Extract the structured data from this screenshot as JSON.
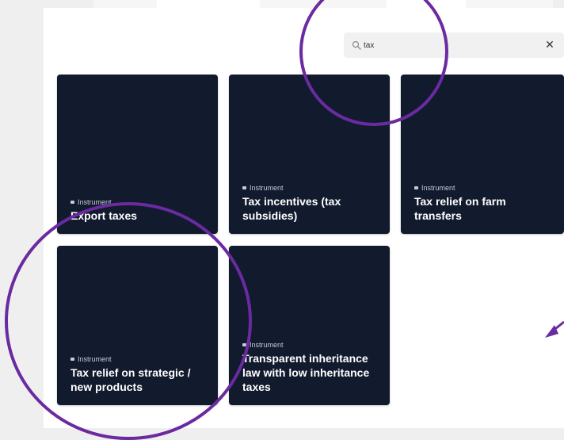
{
  "search": {
    "value": "tax",
    "icon": "search-icon",
    "clear_icon": "close-icon",
    "clear_glyph": "✕"
  },
  "cards": [
    {
      "tag": "Instrument",
      "title": "Export taxes",
      "tag_icon": "instrument-icon"
    },
    {
      "tag": "Instrument",
      "title": "Tax incentives (tax subsidies)",
      "tag_icon": "instrument-icon"
    },
    {
      "tag": "Instrument",
      "title": "Tax relief on farm transfers",
      "tag_icon": "instrument-icon"
    },
    {
      "tag": "Instrument",
      "title": "Tax relief on strategic / new products",
      "tag_icon": "instrument-icon"
    },
    {
      "tag": "Instrument",
      "title": "Transparent inheritance law with low inheritance taxes",
      "tag_icon": "instrument-icon"
    }
  ],
  "colors": {
    "card_background": "#121a2e",
    "annotation": "#6a2aa0",
    "page_background": "#efefef"
  }
}
